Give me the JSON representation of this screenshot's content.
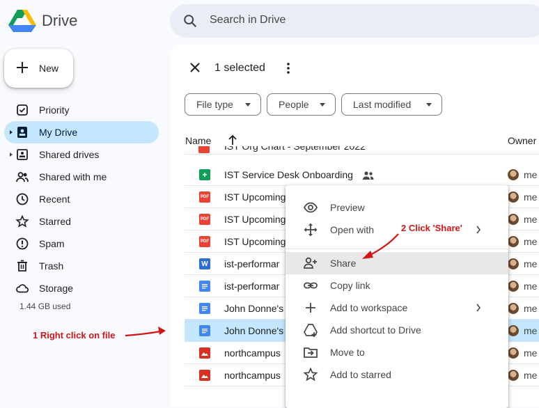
{
  "header": {
    "app_name": "Drive",
    "search_placeholder": "Search in Drive"
  },
  "sidebar": {
    "new_label": "New",
    "items": [
      {
        "label": "Priority",
        "icon": "priority-icon"
      },
      {
        "label": "My Drive",
        "icon": "my-drive-icon",
        "active": true
      },
      {
        "label": "Shared drives",
        "icon": "shared-drives-icon"
      },
      {
        "label": "Shared with me",
        "icon": "shared-with-me-icon"
      },
      {
        "label": "Recent",
        "icon": "clock-icon"
      },
      {
        "label": "Starred",
        "icon": "star-icon"
      },
      {
        "label": "Spam",
        "icon": "spam-icon"
      },
      {
        "label": "Trash",
        "icon": "trash-icon"
      },
      {
        "label": "Storage",
        "icon": "cloud-icon"
      }
    ],
    "storage_used": "1.44 GB used"
  },
  "toolbar": {
    "selected_text": "1 selected"
  },
  "filters": [
    "File type",
    "People",
    "Last modified"
  ],
  "table": {
    "col_name": "Name",
    "col_owner": "Owner",
    "partial_top_row": "IST Org Chart - September 2022",
    "rows": [
      {
        "name": "IST Service Desk Onboarding",
        "type": "sheets",
        "owner": "me",
        "shared": true
      },
      {
        "name": "IST Upcoming",
        "type": "pdf",
        "owner": "me"
      },
      {
        "name": "IST Upcoming",
        "type": "pdf",
        "owner": "me"
      },
      {
        "name": "IST Upcoming",
        "type": "pdf",
        "owner": "me"
      },
      {
        "name": "ist-performar",
        "type": "word",
        "owner": "me"
      },
      {
        "name": "ist-performar",
        "type": "docs",
        "owner": "me"
      },
      {
        "name": "John Donne's",
        "type": "docs",
        "owner": "me"
      },
      {
        "name": "John Donne's",
        "type": "docs",
        "owner": "me",
        "selected": true
      },
      {
        "name": "northcampus",
        "type": "image",
        "owner": "me"
      },
      {
        "name": "northcampus",
        "type": "image",
        "owner": "me"
      }
    ]
  },
  "context_menu": {
    "items": [
      {
        "label": "Preview",
        "icon": "eye-icon"
      },
      {
        "label": "Open with",
        "icon": "open-with-icon",
        "submenu": true
      },
      {
        "label": "Share",
        "icon": "person-add-icon",
        "highlighted": true
      },
      {
        "label": "Copy link",
        "icon": "link-icon"
      },
      {
        "label": "Add to workspace",
        "icon": "plus-icon",
        "submenu": true
      },
      {
        "label": "Add shortcut to Drive",
        "icon": "add-shortcut-icon"
      },
      {
        "label": "Move to",
        "icon": "move-to-icon"
      },
      {
        "label": "Add to starred",
        "icon": "star-outline-icon"
      }
    ]
  },
  "annotations": {
    "step1": "1 Right click on file",
    "step2": "2 Click 'Share'"
  },
  "colors": {
    "accent_selected": "#c2e7ff",
    "annotation_red": "#d31515",
    "pdf_red": "#ea4335",
    "docs_blue": "#4285f4",
    "sheets_green": "#0f9d58"
  }
}
